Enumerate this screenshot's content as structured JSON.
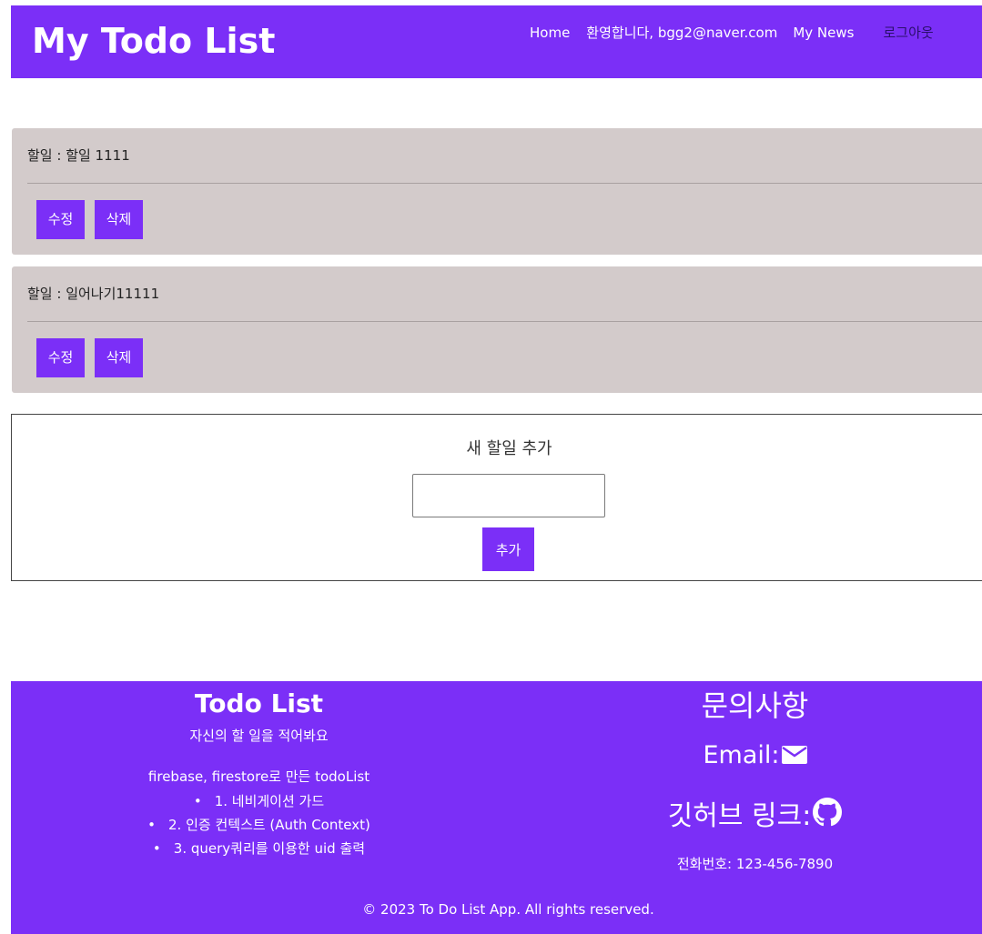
{
  "header": {
    "brand": "My Todo List",
    "nav": {
      "home": "Home",
      "welcome": "환영합니다, bgg2@naver.com",
      "news": "My News",
      "logout": "로그아웃"
    }
  },
  "todos": [
    {
      "text": "할일 : 할일 1111",
      "edit_label": "수정",
      "delete_label": "삭제"
    },
    {
      "text": "할일 : 일어나기11111",
      "edit_label": "수정",
      "delete_label": "삭제"
    }
  ],
  "add_form": {
    "title": "새 할일 추가",
    "input_value": "",
    "button_label": "추가"
  },
  "footer": {
    "title": "Todo List",
    "subtitle": "자신의 할 일을 적어봐요",
    "description": "firebase, firestore로 만든 todoList",
    "features": [
      "1. 네비게이션 가드",
      "2. 인증 컨텍스트 (Auth Context)",
      "3. query쿼리를 이용한 uid 출력"
    ],
    "contact": {
      "title": "문의사항",
      "email_label": "Email:",
      "email_icon": "envelope-icon",
      "github_label": "깃허브 링크:",
      "github_icon": "github-icon",
      "phone": "전화번호: 123-456-7890"
    },
    "copyright": "© 2023 To Do List App. All rights reserved."
  },
  "colors": {
    "primary": "#7b2ff7",
    "card_bg": "#d3cbcb",
    "logout_text": "#2a0f6b"
  }
}
